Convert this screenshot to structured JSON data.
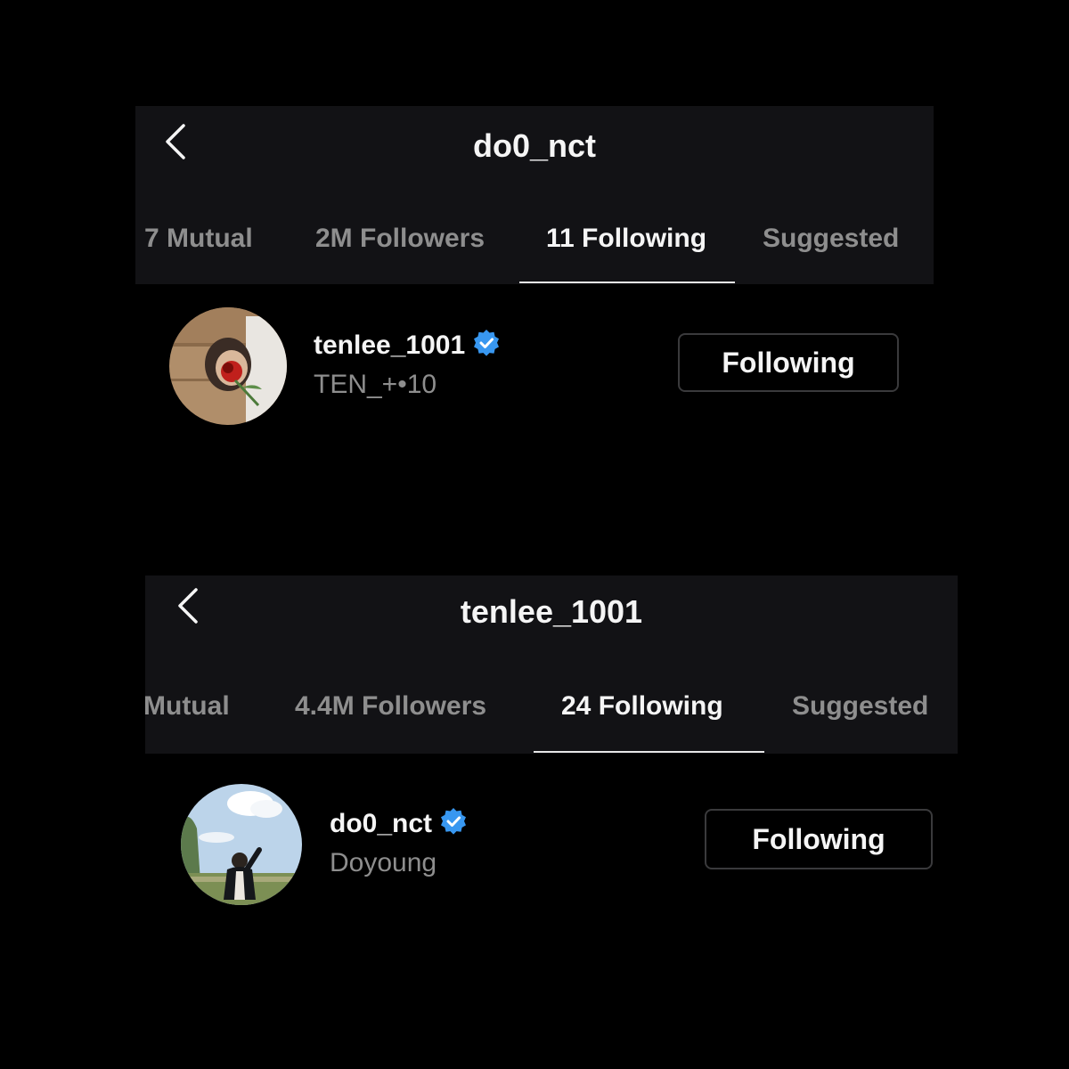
{
  "screens": [
    {
      "title": "do0_nct",
      "tabs": [
        {
          "label": "7 Mutual",
          "active": false
        },
        {
          "label": "2M Followers",
          "active": false
        },
        {
          "label": "11 Following",
          "active": true
        },
        {
          "label": "Suggested",
          "active": false
        }
      ],
      "user": {
        "username": "tenlee_1001",
        "fullname": "TEN_+•10",
        "verified": true,
        "button_label": "Following"
      }
    },
    {
      "title": "tenlee_1001",
      "tabs": [
        {
          "label": "Mutual",
          "active": false
        },
        {
          "label": "4.4M Followers",
          "active": false
        },
        {
          "label": "24 Following",
          "active": true
        },
        {
          "label": "Suggested",
          "active": false
        }
      ],
      "user": {
        "username": "do0_nct",
        "fullname": "Doyoung",
        "verified": true,
        "button_label": "Following"
      }
    }
  ],
  "icons": {
    "back": "chevron-left-icon",
    "verified": "verified-badge-icon"
  },
  "colors": {
    "background": "#000000",
    "header": "#121215",
    "text_primary": "#f5f5f5",
    "text_secondary": "#8e8e8e",
    "verified_blue": "#3897f0",
    "button_border": "#3a3a3c"
  }
}
